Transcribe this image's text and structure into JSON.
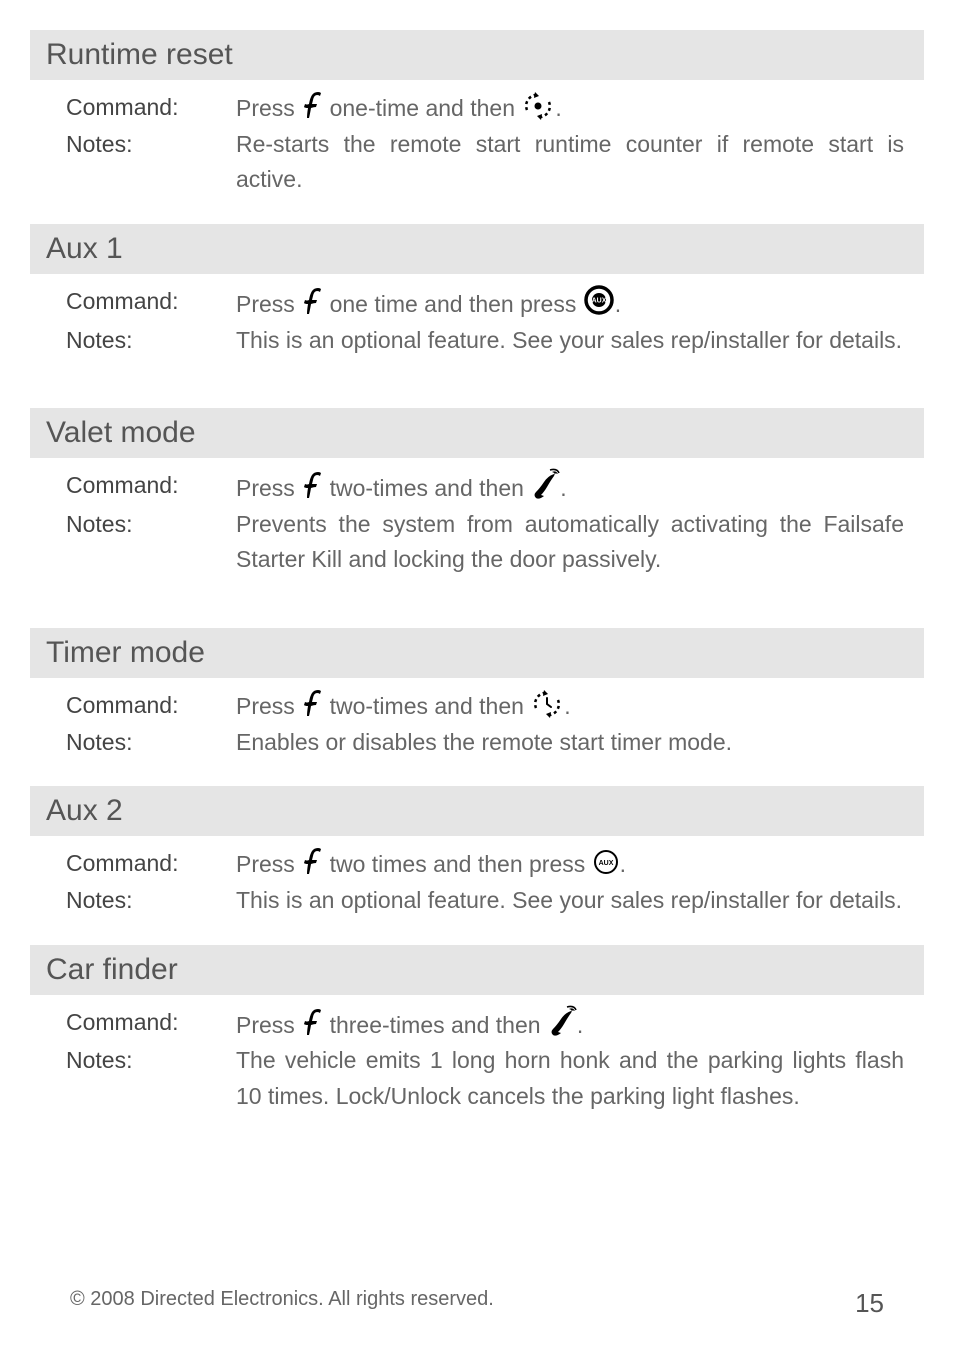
{
  "sections": [
    {
      "title": "Runtime reset",
      "command_prefix": "Press",
      "command_mid": "one-time and then",
      "icon1": "f",
      "icon2": "rotate-dot",
      "notes": "Re-starts the remote start runtime counter if remote start is active."
    },
    {
      "title": "Aux 1",
      "command_prefix": "Press",
      "command_mid": "one time and then press",
      "icon1": "f",
      "icon2": "aux-circle-bold",
      "notes": "This is an optional feature. See your sales rep/installer for details."
    },
    {
      "title": "Valet mode",
      "command_prefix": "Press",
      "command_mid": "two-times and then",
      "icon1": "f",
      "icon2": "s-swoosh",
      "notes": "Prevents the system from automatically activating the Failsafe Starter Kill and locking the door passively."
    },
    {
      "title": "Timer mode",
      "command_prefix": "Press",
      "command_mid": "two-times and then",
      "icon1": "f",
      "icon2": "rotate-clock",
      "notes": "Enables or disables the remote start timer mode."
    },
    {
      "title": "Aux 2",
      "command_prefix": "Press",
      "command_mid": "two times and then press",
      "icon1": "f",
      "icon2": "aux-circle",
      "notes": "This is an optional feature. See your sales rep/installer for details."
    },
    {
      "title": "Car finder",
      "command_prefix": "Press",
      "command_mid": "three-times and then",
      "icon1": "f",
      "icon2": "s-swoosh",
      "notes": "The vehicle emits 1 long horn honk and the parking lights flash 10 times. Lock/Unlock cancels the parking light flashes."
    }
  ],
  "labels": {
    "command": "Command:",
    "notes": "Notes:"
  },
  "gaps_after": [
    false,
    true,
    true,
    false,
    false,
    false
  ],
  "footer": {
    "copyright": "© 2008 Directed Electronics. All rights reserved.",
    "page": "15"
  }
}
